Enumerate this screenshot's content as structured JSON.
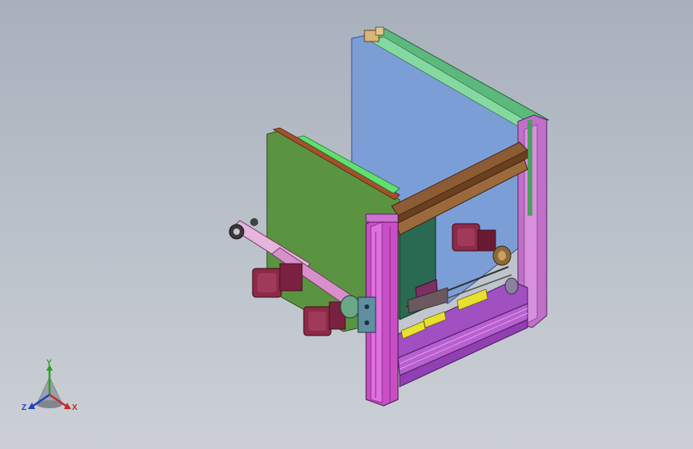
{
  "viewport": {
    "background_top": "#a7b0bc",
    "background_bottom": "#ccd0d6"
  },
  "model": {
    "colors": {
      "back_panel": "#7c9ed6",
      "green_panel": "#5b9440",
      "frame_magenta": "#c84ec4",
      "frame_purple": "#a448c0",
      "green_rail": "#58b478",
      "brown_rail": "#8a5a32",
      "motor_maroon": "#8c2a48",
      "yellow_block": "#e8e030",
      "arm_pink": "#e6b4dc"
    }
  },
  "triad": {
    "y_label": "Y",
    "z_label": "Z",
    "x_label": "X",
    "y_color": "#28a028",
    "z_color": "#2040c0",
    "x_color": "#c82828"
  }
}
